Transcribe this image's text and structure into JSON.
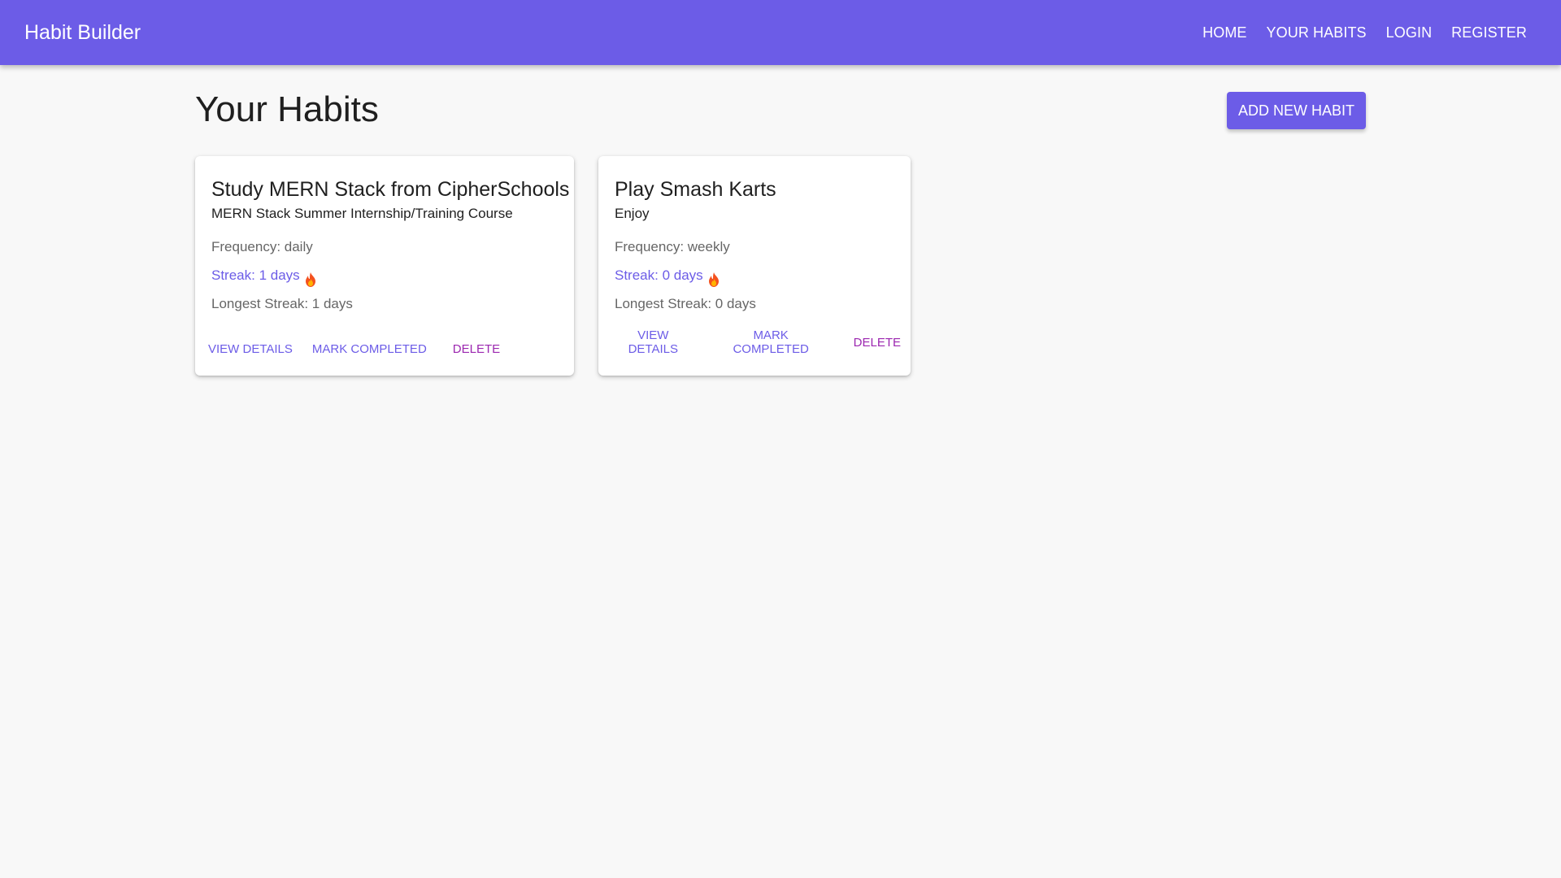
{
  "appbar": {
    "brand": "Habit Builder",
    "nav": [
      "HOME",
      "YOUR HABITS",
      "LOGIN",
      "REGISTER"
    ]
  },
  "page": {
    "title": "Your Habits",
    "add_button": "ADD NEW HABIT"
  },
  "habits": [
    {
      "title": "Study MERN Stack from CipherSchools",
      "description": "MERN Stack Summer Internship/Training Course",
      "frequency": "Frequency: daily",
      "streak": "Streak: 1 days",
      "longest": "Longest Streak: 1 days",
      "actions": {
        "view": "VIEW DETAILS",
        "complete": "MARK COMPLETED",
        "delete": "DELETE"
      }
    },
    {
      "title": "Play Smash Karts",
      "description": "Enjoy",
      "frequency": "Frequency: weekly",
      "streak": "Streak: 0 days",
      "longest": "Longest Streak: 0 days",
      "actions": {
        "view": "VIEW DETAILS",
        "complete": "MARK COMPLETED",
        "delete": "DELETE"
      }
    }
  ],
  "icons": {
    "streak": "fire-icon"
  },
  "colors": {
    "primary": "#6c5ce7",
    "delete": "#9c27b0",
    "background": "#f8f8f8"
  }
}
